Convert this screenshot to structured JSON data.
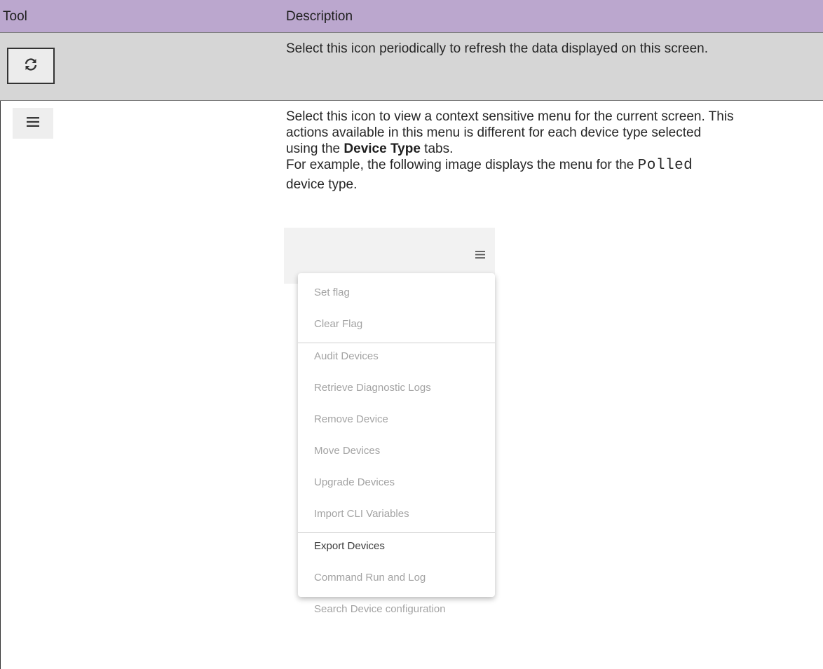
{
  "table": {
    "headers": {
      "tool": "Tool",
      "description": "Description"
    },
    "rows": [
      {
        "tool_icon": "refresh-icon",
        "description": "Select this icon periodically to refresh the data displayed on this screen."
      },
      {
        "tool_icon": "hamburger-menu-icon",
        "description_lines": [
          "Select this icon to view a context sensitive menu for the current screen. This",
          "actions available in this menu is different for each device type selected"
        ],
        "line3_prefix": "using the ",
        "line3_bold": "Device Type",
        "line3_suffix": " tabs.",
        "line4_prefix": "For example, the following image displays the menu for the ",
        "line4_code": "Polled",
        "line5": "device type."
      }
    ]
  },
  "menu_screenshot": {
    "icon": "hamburger-menu-icon",
    "items": [
      {
        "label": "Set flag",
        "enabled": false
      },
      {
        "label": "Clear Flag",
        "enabled": false
      },
      {
        "label": "Audit Devices",
        "enabled": false
      },
      {
        "label": "Retrieve Diagnostic Logs",
        "enabled": false
      },
      {
        "label": "Remove Device",
        "enabled": false
      },
      {
        "label": "Move Devices",
        "enabled": false
      },
      {
        "label": "Upgrade Devices",
        "enabled": false
      },
      {
        "label": "Import CLI Variables",
        "enabled": false
      },
      {
        "label": "Export Devices",
        "enabled": true
      },
      {
        "label": "Command Run and Log",
        "enabled": false
      },
      {
        "label": "Search Device configuration",
        "enabled": false
      }
    ],
    "colors": {
      "enabled_text": "#3a3a3a",
      "disabled_text": "#a3a3a3"
    }
  },
  "colors": {
    "header_bg": "#bba7ce",
    "row1_bg": "#d6d6d6"
  }
}
